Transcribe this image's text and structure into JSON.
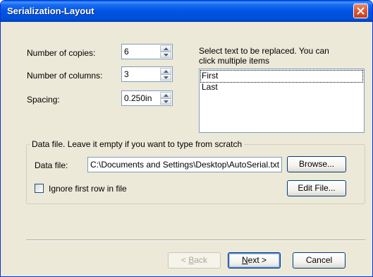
{
  "window": {
    "title": "Serialization-Layout"
  },
  "fields": {
    "copies": {
      "label": "Number of copies:",
      "value": "6"
    },
    "columns": {
      "label": "Number of columns:",
      "value": "3"
    },
    "spacing": {
      "label": "Spacing:",
      "value": "0.250in"
    }
  },
  "replace": {
    "instructions_line1": "Select text to be replaced. You can",
    "instructions_line2": "click multiple items",
    "items": [
      "First",
      "Last"
    ]
  },
  "datafile": {
    "group_title": "Data file. Leave it empty if you want to type from scratch",
    "label": "Data file:",
    "value": "C:\\Documents and Settings\\Desktop\\AutoSerial.txt",
    "browse_label": "Browse...",
    "ignore_label": "Ignore first row in file",
    "ignore_checked": false,
    "edit_label": "Edit File..."
  },
  "buttons": {
    "back_prefix": "< ",
    "back_mnemonic": "B",
    "back_rest": "ack",
    "next_mnemonic": "N",
    "next_rest": "ext >",
    "cancel": "Cancel"
  }
}
